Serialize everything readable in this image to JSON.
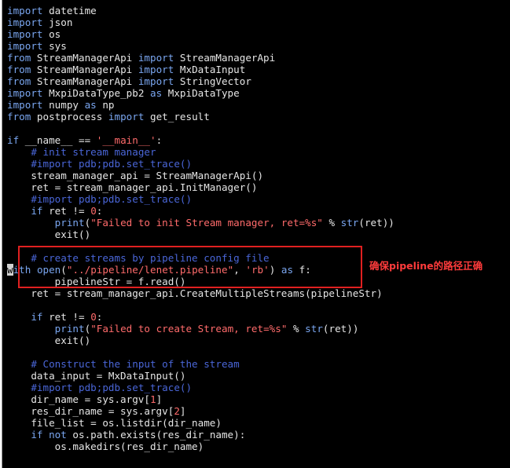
{
  "editor": {
    "lines": [
      [
        {
          "t": "kw",
          "v": "import"
        },
        {
          "t": "ident",
          "v": " datetime"
        }
      ],
      [
        {
          "t": "kw",
          "v": "import"
        },
        {
          "t": "ident",
          "v": " json"
        }
      ],
      [
        {
          "t": "kw",
          "v": "import"
        },
        {
          "t": "ident",
          "v": " os"
        }
      ],
      [
        {
          "t": "kw",
          "v": "import"
        },
        {
          "t": "ident",
          "v": " sys"
        }
      ],
      [
        {
          "t": "kw",
          "v": "from"
        },
        {
          "t": "ident",
          "v": " StreamManagerApi "
        },
        {
          "t": "kw",
          "v": "import"
        },
        {
          "t": "ident",
          "v": " StreamManagerApi"
        }
      ],
      [
        {
          "t": "kw",
          "v": "from"
        },
        {
          "t": "ident",
          "v": " StreamManagerApi "
        },
        {
          "t": "kw",
          "v": "import"
        },
        {
          "t": "ident",
          "v": " MxDataInput"
        }
      ],
      [
        {
          "t": "kw",
          "v": "from"
        },
        {
          "t": "ident",
          "v": " StreamManagerApi "
        },
        {
          "t": "kw",
          "v": "import"
        },
        {
          "t": "ident",
          "v": " StringVector"
        }
      ],
      [
        {
          "t": "kw",
          "v": "import"
        },
        {
          "t": "ident",
          "v": " MxpiDataType_pb2 "
        },
        {
          "t": "kw",
          "v": "as"
        },
        {
          "t": "ident",
          "v": " MxpiDataType"
        }
      ],
      [
        {
          "t": "kw",
          "v": "import"
        },
        {
          "t": "ident",
          "v": " numpy "
        },
        {
          "t": "kw",
          "v": "as"
        },
        {
          "t": "ident",
          "v": " np"
        }
      ],
      [
        {
          "t": "kw",
          "v": "from"
        },
        {
          "t": "ident",
          "v": " postprocess "
        },
        {
          "t": "kw",
          "v": "import"
        },
        {
          "t": "ident",
          "v": " get_result"
        }
      ],
      [],
      [
        {
          "t": "kw",
          "v": "if"
        },
        {
          "t": "ident",
          "v": " __name__ == "
        },
        {
          "t": "str",
          "v": "'__main__'"
        },
        {
          "t": "ident",
          "v": ":"
        }
      ],
      [
        {
          "t": "ident",
          "v": "    "
        },
        {
          "t": "cmt",
          "v": "# init stream manager"
        }
      ],
      [
        {
          "t": "ident",
          "v": "    "
        },
        {
          "t": "cmt",
          "v": "#import pdb;pdb.set_trace()"
        }
      ],
      [
        {
          "t": "ident",
          "v": "    stream_manager_api = StreamManagerApi()"
        }
      ],
      [
        {
          "t": "ident",
          "v": "    ret = stream_manager_api.InitManager()"
        }
      ],
      [
        {
          "t": "ident",
          "v": "    "
        },
        {
          "t": "cmt",
          "v": "#import pdb;pdb.set_trace()"
        }
      ],
      [
        {
          "t": "ident",
          "v": "    "
        },
        {
          "t": "kw",
          "v": "if"
        },
        {
          "t": "ident",
          "v": " ret != "
        },
        {
          "t": "num",
          "v": "0"
        },
        {
          "t": "ident",
          "v": ":"
        }
      ],
      [
        {
          "t": "ident",
          "v": "        "
        },
        {
          "t": "bi",
          "v": "print"
        },
        {
          "t": "ident",
          "v": "("
        },
        {
          "t": "str",
          "v": "\"Failed to init Stream manager, ret=%s\""
        },
        {
          "t": "ident",
          "v": " % "
        },
        {
          "t": "bi",
          "v": "str"
        },
        {
          "t": "ident",
          "v": "(ret))"
        }
      ],
      [
        {
          "t": "ident",
          "v": "        exit()"
        }
      ],
      [],
      [
        {
          "t": "ident",
          "v": "    "
        },
        {
          "t": "cmt",
          "v": "# create streams by pipeline config file"
        }
      ],
      [
        {
          "t": "cursor",
          "v": "w"
        },
        {
          "t": "kw",
          "v": "ith"
        },
        {
          "t": "ident",
          "v": " "
        },
        {
          "t": "bi",
          "v": "open"
        },
        {
          "t": "ident",
          "v": "("
        },
        {
          "t": "str",
          "v": "\"../pipeline/lenet.pipeline\""
        },
        {
          "t": "ident",
          "v": ", "
        },
        {
          "t": "str",
          "v": "'rb'"
        },
        {
          "t": "ident",
          "v": ") "
        },
        {
          "t": "kw",
          "v": "as"
        },
        {
          "t": "ident",
          "v": " f:"
        }
      ],
      [
        {
          "t": "ident",
          "v": "        pipelineStr = f.read()"
        }
      ],
      [
        {
          "t": "ident",
          "v": "    ret = stream_manager_api.CreateMultipleStreams(pipelineStr)"
        }
      ],
      [],
      [
        {
          "t": "ident",
          "v": "    "
        },
        {
          "t": "kw",
          "v": "if"
        },
        {
          "t": "ident",
          "v": " ret != "
        },
        {
          "t": "num",
          "v": "0"
        },
        {
          "t": "ident",
          "v": ":"
        }
      ],
      [
        {
          "t": "ident",
          "v": "        "
        },
        {
          "t": "bi",
          "v": "print"
        },
        {
          "t": "ident",
          "v": "("
        },
        {
          "t": "str",
          "v": "\"Failed to create Stream, ret=%s\""
        },
        {
          "t": "ident",
          "v": " % "
        },
        {
          "t": "bi",
          "v": "str"
        },
        {
          "t": "ident",
          "v": "(ret))"
        }
      ],
      [
        {
          "t": "ident",
          "v": "        exit()"
        }
      ],
      [],
      [
        {
          "t": "ident",
          "v": "    "
        },
        {
          "t": "cmt",
          "v": "# Construct the input of the stream"
        }
      ],
      [
        {
          "t": "ident",
          "v": "    data_input = MxDataInput()"
        }
      ],
      [
        {
          "t": "ident",
          "v": "    "
        },
        {
          "t": "cmt",
          "v": "#import pdb;pdb.set_trace()"
        }
      ],
      [
        {
          "t": "ident",
          "v": "    dir_name = sys.argv["
        },
        {
          "t": "num",
          "v": "1"
        },
        {
          "t": "ident",
          "v": "]"
        }
      ],
      [
        {
          "t": "ident",
          "v": "    res_dir_name = sys.argv["
        },
        {
          "t": "num",
          "v": "2"
        },
        {
          "t": "ident",
          "v": "]"
        }
      ],
      [
        {
          "t": "ident",
          "v": "    file_list = os.listdir(dir_name)"
        }
      ],
      [
        {
          "t": "ident",
          "v": "    "
        },
        {
          "t": "kw",
          "v": "if not"
        },
        {
          "t": "ident",
          "v": " os.path.exists(res_dir_name):"
        }
      ],
      [
        {
          "t": "ident",
          "v": "        os.makedirs(res_dir_name)"
        }
      ]
    ]
  },
  "annotation": {
    "text": "确保pipeline的路径正确",
    "color": "#ff3b3b"
  }
}
